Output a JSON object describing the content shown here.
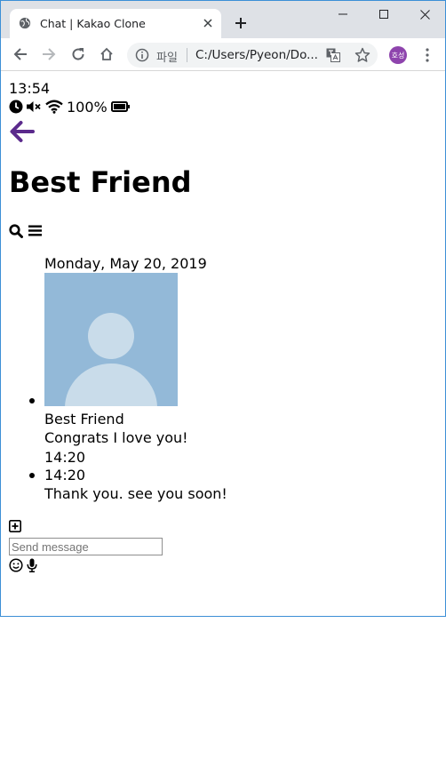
{
  "browser": {
    "tab_title": "Chat | Kakao Clone",
    "omnibox_scheme": "파일",
    "omnibox_url": "C:/Users/Pyeon/Do...",
    "profile_initials": "호성"
  },
  "status_bar": {
    "time": "13:54",
    "battery": "100%",
    "icons": [
      "clock-icon",
      "volume-mute-icon",
      "wifi-icon",
      "battery-full-icon"
    ]
  },
  "header": {
    "back_icon": "arrow-left-icon",
    "title": "Best Friend",
    "actions": [
      "search-icon",
      "bars-icon"
    ]
  },
  "chat": {
    "date": "Monday, May 20, 2019",
    "messages": [
      {
        "sender": "Best Friend",
        "text": "Congrats I love you!",
        "time": "14:20"
      },
      {
        "time": "14:20",
        "text": "Thank you. see you soon!"
      }
    ]
  },
  "composer": {
    "plus_icon": "plus-square-icon",
    "placeholder": "Send message",
    "value": "",
    "icons": [
      "smile-icon",
      "microphone-icon"
    ]
  },
  "colors": {
    "accent": "#5b2a8c",
    "avatar_bg": "#93b9d8",
    "avatar_fg": "#c9dcea",
    "profile_bg": "#8e44ad"
  }
}
